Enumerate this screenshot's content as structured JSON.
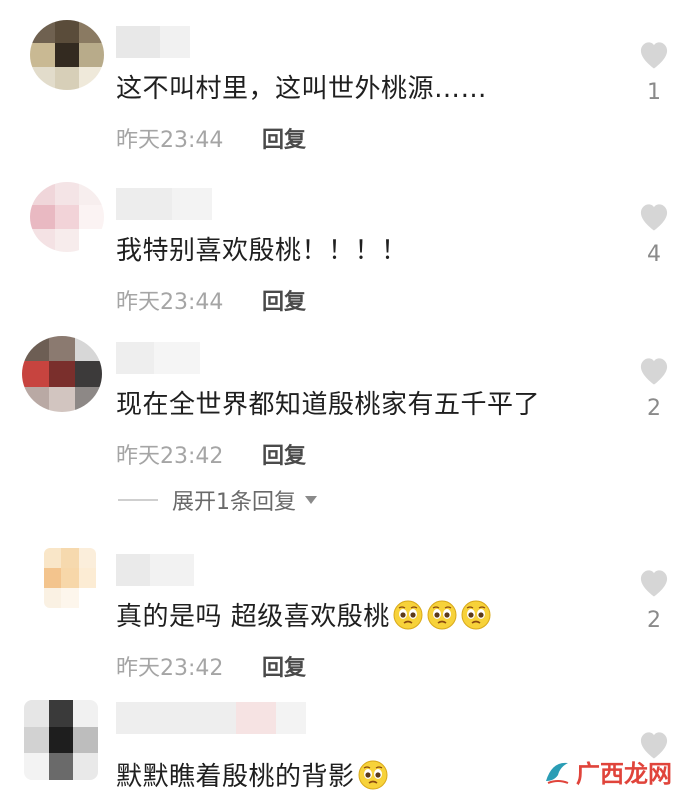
{
  "comments": [
    {
      "text": "这不叫村里，这叫世外桃源……",
      "time": "昨天23:44",
      "reply_label": "回复",
      "likes": "1",
      "emoji_count": 0
    },
    {
      "text": "我特别喜欢殷桃！！！！",
      "time": "昨天23:44",
      "reply_label": "回复",
      "likes": "4",
      "emoji_count": 0
    },
    {
      "text": "现在全世界都知道殷桃家有五千平了",
      "time": "昨天23:42",
      "reply_label": "回复",
      "likes": "2",
      "emoji_count": 0
    },
    {
      "text": "真的是吗 超级喜欢殷桃",
      "time": "昨天23:42",
      "reply_label": "回复",
      "likes": "2",
      "emoji_count": 3
    },
    {
      "text": "默默瞧着殷桃的背影",
      "time": "",
      "reply_label": "",
      "likes": "",
      "emoji_count": 1
    }
  ],
  "expand_replies": {
    "label": "展开1条回复"
  },
  "watermark": {
    "text": "广西龙网"
  },
  "colors": {
    "heart": "#d6d6d6",
    "text": "#1f1f1f",
    "meta": "#a5a5a5",
    "watermark_red": "#e0443b",
    "watermark_teal": "#2a9db5"
  },
  "icons": {
    "like": "heart-icon",
    "expand": "triangle-down-icon",
    "emoji": "pleading-face-emoji"
  }
}
